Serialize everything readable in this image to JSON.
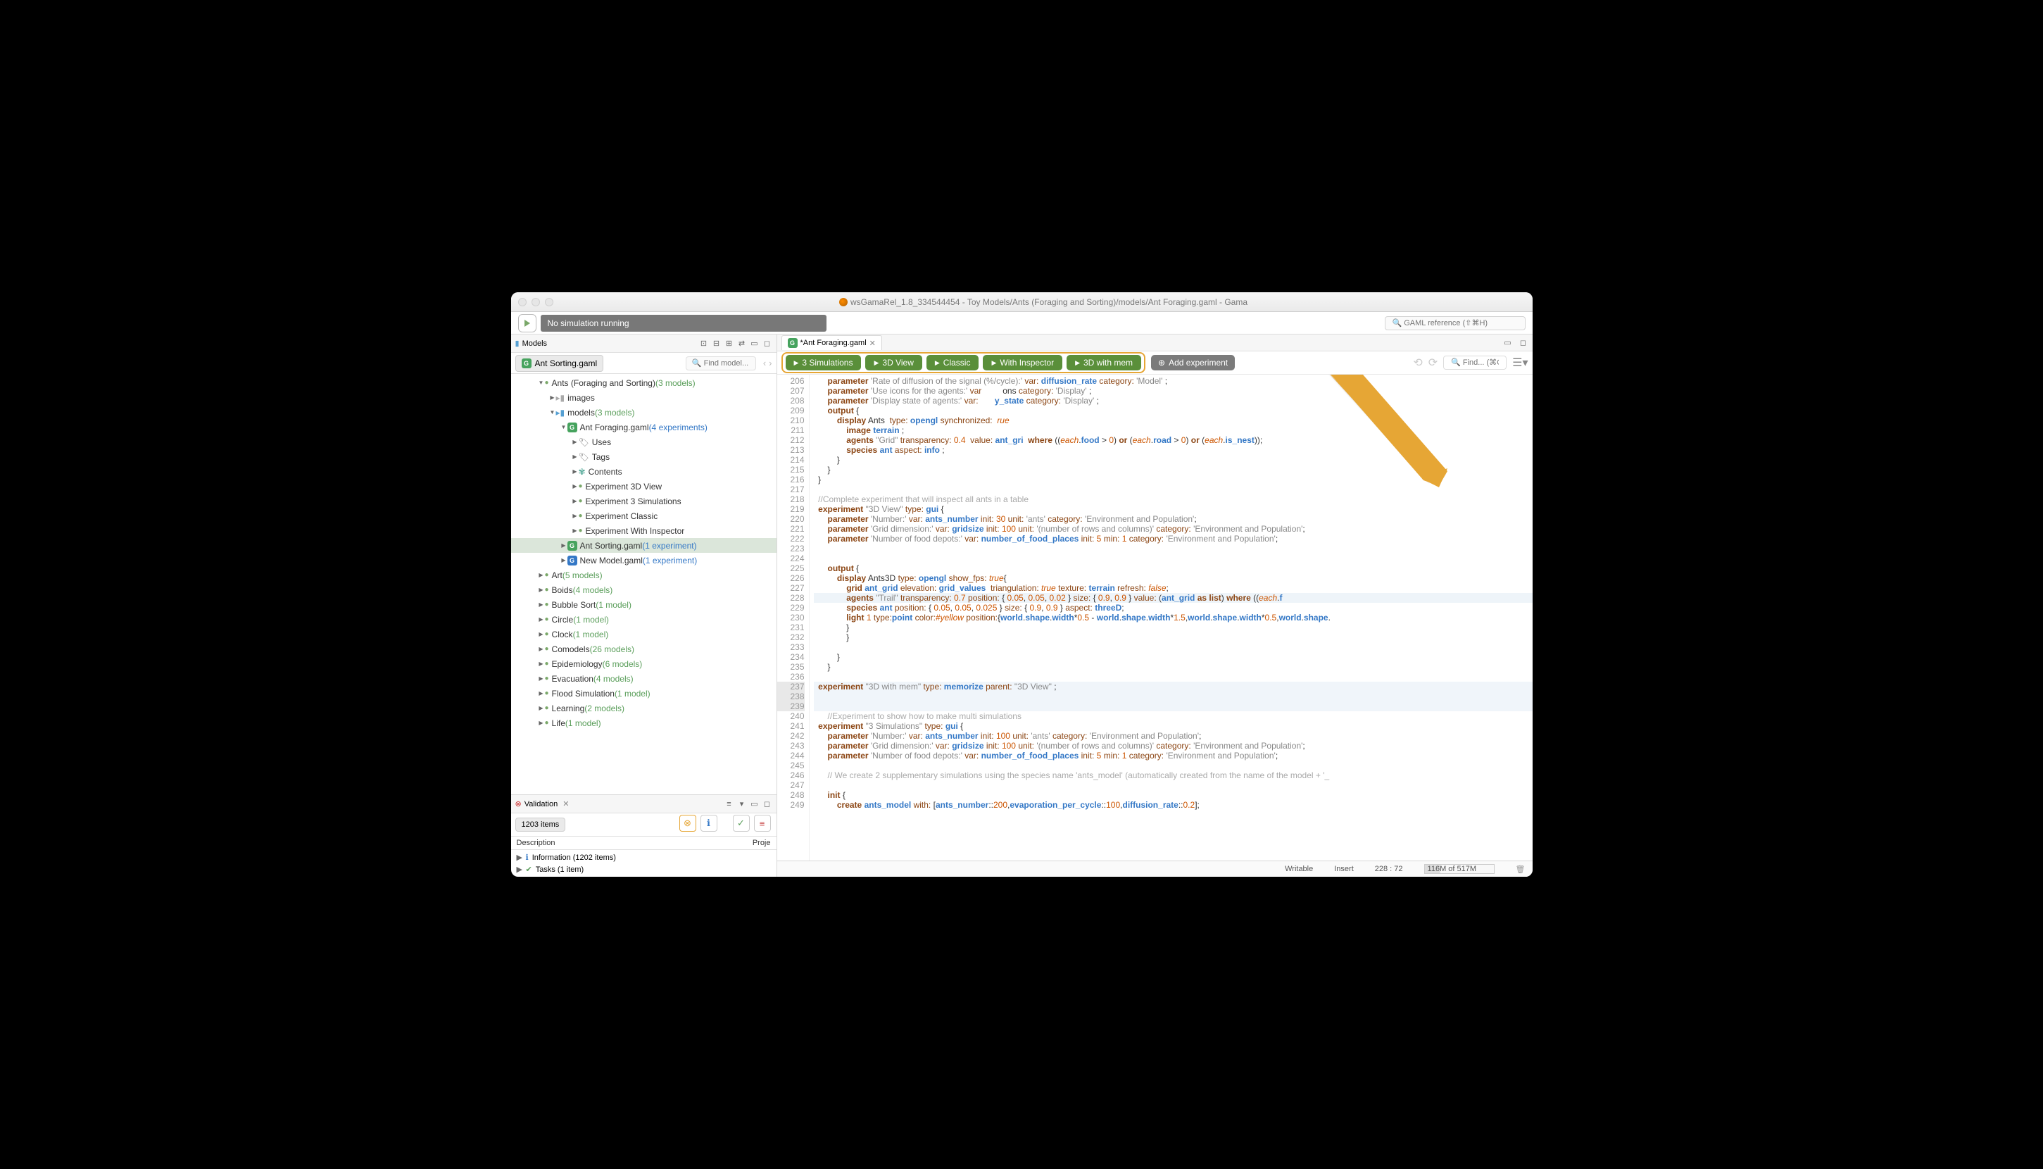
{
  "window": {
    "title": "wsGamaRel_1.8_334544454 - Toy Models/Ants (Foraging and Sorting)/models/Ant Foraging.gaml - Gama"
  },
  "toolbar": {
    "status": "No simulation running",
    "search_placeholder": "🔍 GAML reference (⇧⌘H)"
  },
  "models_panel": {
    "title": "Models",
    "tab": "Ant Sorting.gaml",
    "find_placeholder": "🔍 Find model..."
  },
  "tree": [
    {
      "ind": 2,
      "arrow": "▼",
      "icon": "dot",
      "label": "Ants (Foraging and Sorting)",
      "count": "(3 models)",
      "cc": "green"
    },
    {
      "ind": 3,
      "arrow": "▶",
      "icon": "folder-gray",
      "label": "images"
    },
    {
      "ind": 3,
      "arrow": "▼",
      "icon": "folder",
      "label": "models",
      "count": "(3 models)",
      "cc": "green"
    },
    {
      "ind": 4,
      "arrow": "▼",
      "icon": "g",
      "label": "Ant Foraging.gaml",
      "count": "(4 experiments)",
      "cc": "blue"
    },
    {
      "ind": 5,
      "arrow": "▶",
      "icon": "tag",
      "label": "Uses"
    },
    {
      "ind": 5,
      "arrow": "▶",
      "icon": "tags",
      "label": "Tags"
    },
    {
      "ind": 5,
      "arrow": "▶",
      "icon": "wheel",
      "label": "Contents"
    },
    {
      "ind": 5,
      "arrow": "▶",
      "icon": "dot",
      "label": "Experiment 3D View"
    },
    {
      "ind": 5,
      "arrow": "▶",
      "icon": "dot",
      "label": "Experiment 3 Simulations"
    },
    {
      "ind": 5,
      "arrow": "▶",
      "icon": "dot",
      "label": "Experiment Classic"
    },
    {
      "ind": 5,
      "arrow": "▶",
      "icon": "dot",
      "label": "Experiment With Inspector"
    },
    {
      "ind": 4,
      "arrow": "▶",
      "icon": "g",
      "label": "Ant Sorting.gaml",
      "count": "(1 experiment)",
      "cc": "blue",
      "selected": true
    },
    {
      "ind": 4,
      "arrow": "▶",
      "icon": "g-blue",
      "label": "New Model.gaml",
      "count": "(1 experiment)",
      "cc": "blue"
    },
    {
      "ind": 2,
      "arrow": "▶",
      "icon": "dot",
      "label": "Art",
      "count": "(5 models)",
      "cc": "green"
    },
    {
      "ind": 2,
      "arrow": "▶",
      "icon": "dot",
      "label": "Boids",
      "count": "(4 models)",
      "cc": "green"
    },
    {
      "ind": 2,
      "arrow": "▶",
      "icon": "dot",
      "label": "Bubble Sort",
      "count": "(1 model)",
      "cc": "green"
    },
    {
      "ind": 2,
      "arrow": "▶",
      "icon": "dot",
      "label": "Circle",
      "count": "(1 model)",
      "cc": "green"
    },
    {
      "ind": 2,
      "arrow": "▶",
      "icon": "dot",
      "label": "Clock",
      "count": "(1 model)",
      "cc": "green"
    },
    {
      "ind": 2,
      "arrow": "▶",
      "icon": "dot",
      "label": "Comodels",
      "count": "(26 models)",
      "cc": "green"
    },
    {
      "ind": 2,
      "arrow": "▶",
      "icon": "dot",
      "label": "Epidemiology",
      "count": "(6 models)",
      "cc": "green"
    },
    {
      "ind": 2,
      "arrow": "▶",
      "icon": "dot",
      "label": "Evacuation",
      "count": "(4 models)",
      "cc": "green"
    },
    {
      "ind": 2,
      "arrow": "▶",
      "icon": "dot",
      "label": "Flood Simulation",
      "count": "(1 model)",
      "cc": "green"
    },
    {
      "ind": 2,
      "arrow": "▶",
      "icon": "dot",
      "label": "Learning",
      "count": "(2 models)",
      "cc": "green"
    },
    {
      "ind": 2,
      "arrow": "▶",
      "icon": "dot",
      "label": "Life",
      "count": "(1 model)",
      "cc": "green"
    }
  ],
  "validation": {
    "title": "Validation",
    "items": "1203 items",
    "col1": "Description",
    "col2": "Proje",
    "rows": [
      {
        "icon": "ℹ",
        "label": "Information (1202 items)"
      },
      {
        "icon": "✔",
        "label": "Tasks (1 item)"
      }
    ]
  },
  "editor": {
    "tab": "*Ant Foraging.gaml",
    "experiments": [
      "3 Simulations",
      "3D View",
      "Classic",
      "With Inspector",
      "3D with mem"
    ],
    "add_exp": "Add experiment",
    "find_placeholder": "🔍 Find... (⌘G)"
  },
  "code_lines": [
    {
      "n": 206,
      "html": "      <span class='kw'>parameter</span> <span class='str'>'Rate of diffusion of the signal (%/cycle):'</span> <span class='attr'>var:</span> <span class='id'>diffusion_rate</span> <span class='attr'>category:</span> <span class='str'>'Model'</span> ;"
    },
    {
      "n": 207,
      "html": "      <span class='kw'>parameter</span> <span class='str'>'Use icons for the agents:'</span> <span class='attr'>var</span>         ons <span class='attr'>category:</span> <span class='str'>'Display'</span> ;"
    },
    {
      "n": 208,
      "html": "      <span class='kw'>parameter</span> <span class='str'>'Display state of agents:'</span> <span class='attr'>var:</span>       <span class='id'>y_state</span> <span class='attr'>category:</span> <span class='str'>'Display'</span> ;"
    },
    {
      "n": 209,
      "html": "      <span class='kw'>output</span> {"
    },
    {
      "n": 210,
      "html": "          <span class='kw'>display</span> Ants  <span class='attr'>type:</span> <span class='id'>opengl</span> <span class='attr'>synchronized:</span>  <span class='bool'>rue</span>"
    },
    {
      "n": 211,
      "html": "              <span class='kw'>image</span> <span class='id'>terrain</span> ;"
    },
    {
      "n": 212,
      "html": "              <span class='kw'>agents</span> <span class='str'>\"Grid\"</span> <span class='attr'>transparency:</span> <span class='num'>0.4</span>  <span class='attr'>value:</span> <span class='id'>ant_gri</span>  <span class='kw'>where</span> ((<span class='bool'>each</span>.<span class='id'>food</span> > <span class='num'>0</span>) <span class='kw'>or</span> (<span class='bool'>each</span>.<span class='id'>road</span> > <span class='num'>0</span>) <span class='kw'>or</span> (<span class='bool'>each</span>.<span class='id'>is_nest</span>));"
    },
    {
      "n": 213,
      "html": "              <span class='kw'>species</span> <span class='id'>ant</span> <span class='attr'>aspect:</span> <span class='id'>info</span> ;"
    },
    {
      "n": 214,
      "html": "          }"
    },
    {
      "n": 215,
      "html": "      }"
    },
    {
      "n": 216,
      "html": "  }"
    },
    {
      "n": 217,
      "html": ""
    },
    {
      "n": 218,
      "html": "  <span class='cm'>//Complete experiment that will inspect all ants in a table</span>"
    },
    {
      "n": 219,
      "html": "  <span class='kw'>experiment</span> <span class='str'>\"3D View\"</span> <span class='attr'>type:</span> <span class='id'>gui</span> {"
    },
    {
      "n": 220,
      "html": "      <span class='kw'>parameter</span> <span class='str'>'Number:'</span> <span class='attr'>var:</span> <span class='id'>ants_number</span> <span class='attr'>init:</span> <span class='num'>30</span> <span class='attr'>unit:</span> <span class='str'>'ants'</span> <span class='attr'>category:</span> <span class='str'>'Environment and Population'</span>;"
    },
    {
      "n": 221,
      "html": "      <span class='kw'>parameter</span> <span class='str'>'Grid dimension:'</span> <span class='attr'>var:</span> <span class='id'>gridsize</span> <span class='attr'>init:</span> <span class='num'>100</span> <span class='attr'>unit:</span> <span class='str'>'(number of rows and columns)'</span> <span class='attr'>category:</span> <span class='str'>'Environment and Population'</span>;"
    },
    {
      "n": 222,
      "html": "      <span class='kw'>parameter</span> <span class='str'>'Number of food depots:'</span> <span class='attr'>var:</span> <span class='id'>number_of_food_places</span> <span class='attr'>init:</span> <span class='num'>5</span> <span class='attr'>min:</span> <span class='num'>1</span> <span class='attr'>category:</span> <span class='str'>'Environment and Population'</span>;"
    },
    {
      "n": 223,
      "html": ""
    },
    {
      "n": 224,
      "html": ""
    },
    {
      "n": 225,
      "html": "      <span class='kw'>output</span> {"
    },
    {
      "n": 226,
      "html": "          <span class='kw'>display</span> Ants3D <span class='attr'>type:</span> <span class='id'>opengl</span> <span class='attr'>show_fps:</span> <span class='bool'>true</span>{"
    },
    {
      "n": 227,
      "html": "              <span class='kw'>grid</span> <span class='id'>ant_grid</span> <span class='attr'>elevation:</span> <span class='id'>grid_values</span>  <span class='attr'>triangulation:</span> <span class='bool'>true</span> <span class='attr'>texture:</span> <span class='id'>terrain</span> <span class='attr'>refresh:</span> <span class='bool'>false</span>;"
    },
    {
      "n": 228,
      "hl": true,
      "html": "              <span class='kw'>agents</span> <span class='str'>\"Trail\"</span> <span class='attr'>transparency:</span> <span class='num'>0.7</span> <span class='attr'>position:</span> { <span class='num'>0.05</span>, <span class='num'>0.05</span>, <span class='num'>0.02</span> } <span class='attr'>size:</span> { <span class='num'>0.9</span>, <span class='num'>0.9</span> } <span class='attr'>value:</span> (<span class='id'>ant_grid</span> <span class='kw'>as</span> <span class='kw'>list</span>) <span class='kw'>where</span> ((<span class='bool'>each</span>.<span class='id'>f</span>"
    },
    {
      "n": 229,
      "html": "              <span class='kw'>species</span> <span class='id'>ant</span> <span class='attr'>position:</span> { <span class='num'>0.05</span>, <span class='num'>0.05</span>, <span class='num'>0.025</span> } <span class='attr'>size:</span> { <span class='num'>0.9</span>, <span class='num'>0.9</span> } <span class='attr'>aspect:</span> <span class='id'>threeD</span>;"
    },
    {
      "n": 230,
      "html": "              <span class='kw'>light</span> <span class='num'>1</span> <span class='attr'>type:</span><span class='id'>point</span> <span class='attr'>color:</span><span class='bool'>#yellow</span> <span class='attr'>position:</span>{<span class='id'>world</span>.<span class='id'>shape</span>.<span class='id'>width</span>*<span class='num'>0.5</span> - <span class='id'>world</span>.<span class='id'>shape</span>.<span class='id'>width</span>*<span class='num'>1.5</span>,<span class='id'>world</span>.<span class='id'>shape</span>.<span class='id'>width</span>*<span class='num'>0.5</span>,<span class='id'>world</span>.<span class='id'>shape</span>."
    },
    {
      "n": 231,
      "html": "              }"
    },
    {
      "n": 232,
      "html": "              }"
    },
    {
      "n": 233,
      "html": ""
    },
    {
      "n": 234,
      "html": "          }"
    },
    {
      "n": 235,
      "html": "      }"
    },
    {
      "n": 236,
      "html": ""
    },
    {
      "n": 237,
      "hl2": true,
      "html": "  <span class='kw'>experiment</span> <span class='str'>\"3D with mem\"</span> <span class='attr'>type:</span> <span class='id'>memorize</span> <span class='attr'>parent:</span> <span class='str'>\"3D View\"</span> ;"
    },
    {
      "n": 238,
      "hl2": true,
      "html": ""
    },
    {
      "n": 239,
      "hl2": true,
      "html": ""
    },
    {
      "n": 240,
      "html": "      <span class='cm'>//Experiment to show how to make multi simulations</span>"
    },
    {
      "n": 241,
      "html": "  <span class='kw'>experiment</span> <span class='str'>\"3 Simulations\"</span> <span class='attr'>type:</span> <span class='id'>gui</span> {"
    },
    {
      "n": 242,
      "html": "      <span class='kw'>parameter</span> <span class='str'>'Number:'</span> <span class='attr'>var:</span> <span class='id'>ants_number</span> <span class='attr'>init:</span> <span class='num'>100</span> <span class='attr'>unit:</span> <span class='str'>'ants'</span> <span class='attr'>category:</span> <span class='str'>'Environment and Population'</span>;"
    },
    {
      "n": 243,
      "html": "      <span class='kw'>parameter</span> <span class='str'>'Grid dimension:'</span> <span class='attr'>var:</span> <span class='id'>gridsize</span> <span class='attr'>init:</span> <span class='num'>100</span> <span class='attr'>unit:</span> <span class='str'>'(number of rows and columns)'</span> <span class='attr'>category:</span> <span class='str'>'Environment and Population'</span>;"
    },
    {
      "n": 244,
      "html": "      <span class='kw'>parameter</span> <span class='str'>'Number of food depots:'</span> <span class='attr'>var:</span> <span class='id'>number_of_food_places</span> <span class='attr'>init:</span> <span class='num'>5</span> <span class='attr'>min:</span> <span class='num'>1</span> <span class='attr'>category:</span> <span class='str'>'Environment and Population'</span>;"
    },
    {
      "n": 245,
      "html": ""
    },
    {
      "n": 246,
      "html": "      <span class='cm'>// We create 2 supplementary simulations using the species name 'ants_model' (automatically created from the name of the model + '_</span>"
    },
    {
      "n": 247,
      "html": ""
    },
    {
      "n": 248,
      "html": "      <span class='kw'>init</span> {"
    },
    {
      "n": 249,
      "html": "          <span class='kw'>create</span> <span class='id'>ants_model</span> <span class='attr'>with:</span> [<span class='id'>ants_number</span>::<span class='num'>200</span>,<span class='id'>evaporation_per_cycle</span>::<span class='num'>100</span>,<span class='id'>diffusion_rate</span>::<span class='num'>0.2</span>];"
    }
  ],
  "status": {
    "writable": "Writable",
    "insert": "Insert",
    "pos": "228 : 72",
    "mem": "116M of 517M"
  }
}
